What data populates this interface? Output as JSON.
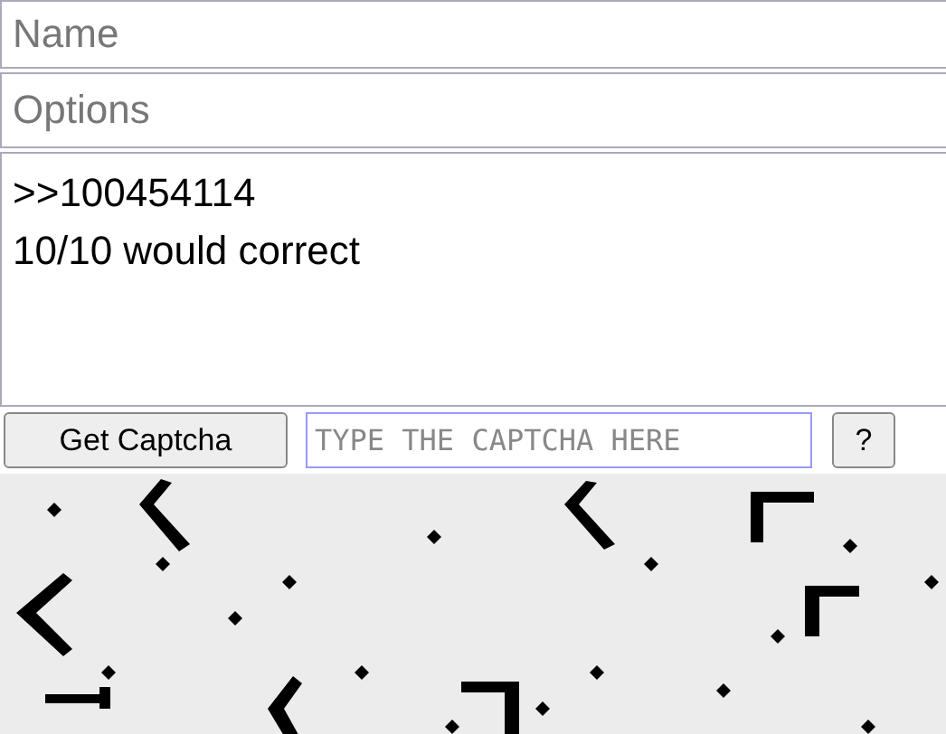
{
  "name_field": {
    "placeholder": "Name"
  },
  "options_field": {
    "placeholder": "Options"
  },
  "comment_field": {
    "value": ">>100454114\n10/10 would correct"
  },
  "get_captcha_button": {
    "label": "Get Captcha"
  },
  "captcha_field": {
    "placeholder": "TYPE THE CAPTCHA HERE"
  },
  "help_button": {
    "label": "?"
  }
}
